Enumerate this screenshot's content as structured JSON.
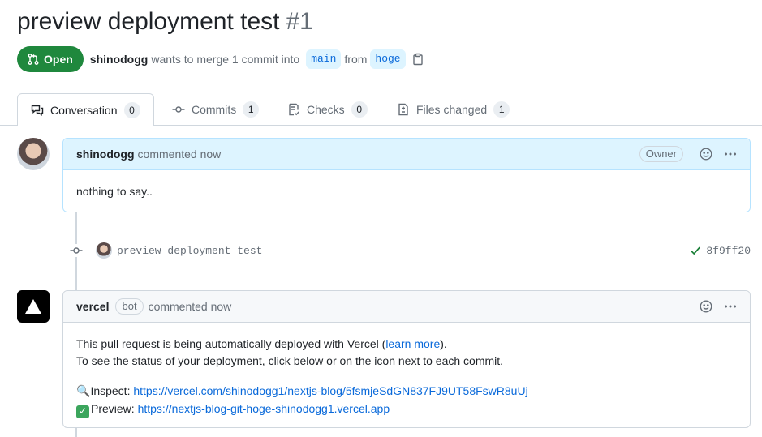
{
  "pr": {
    "title": "preview deployment test",
    "number": "#1",
    "state": "Open",
    "author": "shinodogg",
    "merge_text": "wants to merge 1 commit into",
    "base_branch": "main",
    "from_text": "from",
    "head_branch": "hoge"
  },
  "tabs": [
    {
      "label": "Conversation",
      "count": "0",
      "icon": "comment-discussion-icon"
    },
    {
      "label": "Commits",
      "count": "1",
      "icon": "git-commit-icon"
    },
    {
      "label": "Checks",
      "count": "0",
      "icon": "checklist-icon"
    },
    {
      "label": "Files changed",
      "count": "1",
      "icon": "file-diff-icon"
    }
  ],
  "comments": [
    {
      "author": "shinodogg",
      "meta": "commented now",
      "role": "Owner",
      "body": "nothing to say.."
    },
    {
      "author": "vercel",
      "bot_label": "bot",
      "meta": "commented now",
      "line1_prefix": "This pull request is being automatically deployed with Vercel (",
      "line1_link": "learn more",
      "line1_suffix": ").",
      "line2": "To see the status of your deployment, click below or on the icon next to each commit.",
      "inspect_emoji": "🔍",
      "inspect_label": "Inspect: ",
      "inspect_url": "https://vercel.com/shinodogg1/nextjs-blog/5fsmjeSdGN837FJ9UT58FswR8uUj",
      "preview_emoji": "✓",
      "preview_label": "Preview: ",
      "preview_url": "https://nextjs-blog-git-hoge-shinodogg1.vercel.app"
    }
  ],
  "commit": {
    "message": "preview deployment test",
    "sha": "8f9ff20"
  },
  "colors": {
    "open_green": "#1f883d",
    "link_blue": "#0969da",
    "success_green": "#1a7f37"
  }
}
